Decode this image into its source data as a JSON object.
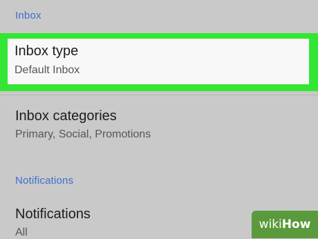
{
  "inbox_section": {
    "header": "Inbox",
    "inbox_type": {
      "title": "Inbox type",
      "subtitle": "Default Inbox"
    },
    "inbox_categories": {
      "title": "Inbox categories",
      "subtitle": "Primary, Social, Promotions"
    }
  },
  "notifications_section": {
    "header": "Notifications",
    "notifications": {
      "title": "Notifications",
      "subtitle": "All"
    }
  },
  "colors": {
    "background": "#c9c9c9",
    "section_header": "#3d6fcf",
    "highlight_border": "#33e633",
    "highlight_fill": "#f8f8f8",
    "watermark": "#5a9a3c"
  },
  "watermark": {
    "part1": "wiki",
    "part2": "How"
  }
}
